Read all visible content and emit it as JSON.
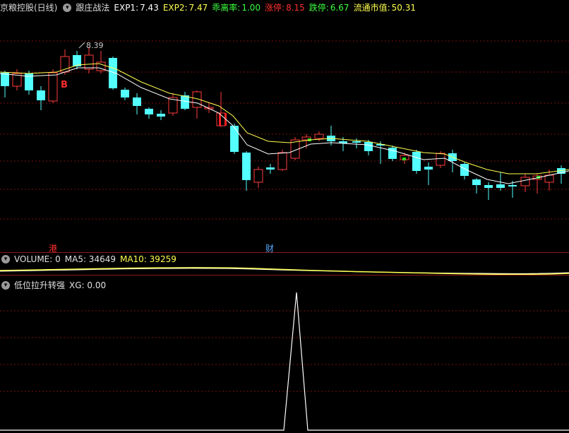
{
  "header": {
    "stock_title": "京粮控股(日线)",
    "indicator_name": "跟庄战法",
    "exp1_label": "EXP1:",
    "exp1_value": "7.43",
    "exp2_label": "EXP2:",
    "exp2_value": "7.47",
    "bias_label": "乖离率:",
    "bias_value": "1.00",
    "limit_up_label": "涨停:",
    "limit_up_value": "8.15",
    "limit_down_label": "跌停:",
    "limit_down_value": "6.67",
    "float_cap_label": "流通市值:",
    "float_cap_value": "50.31"
  },
  "chart": {
    "high_label": "8.39",
    "buy_marker": "B",
    "tag_hk": "港",
    "tag_fin": "财",
    "colors": {
      "up": "#ff3b3b",
      "down": "#54ffff",
      "exp1": "#ffffff",
      "exp2": "#ffff50",
      "grid": "#7a1010"
    }
  },
  "volume_panel": {
    "label": "VOLUME: 0",
    "ma5_label": "MA5: 34649",
    "ma10_label": "MA10: 39259"
  },
  "signal_panel": {
    "name": "低位拉升转强",
    "xg_label": "XG: 0.00"
  }
}
